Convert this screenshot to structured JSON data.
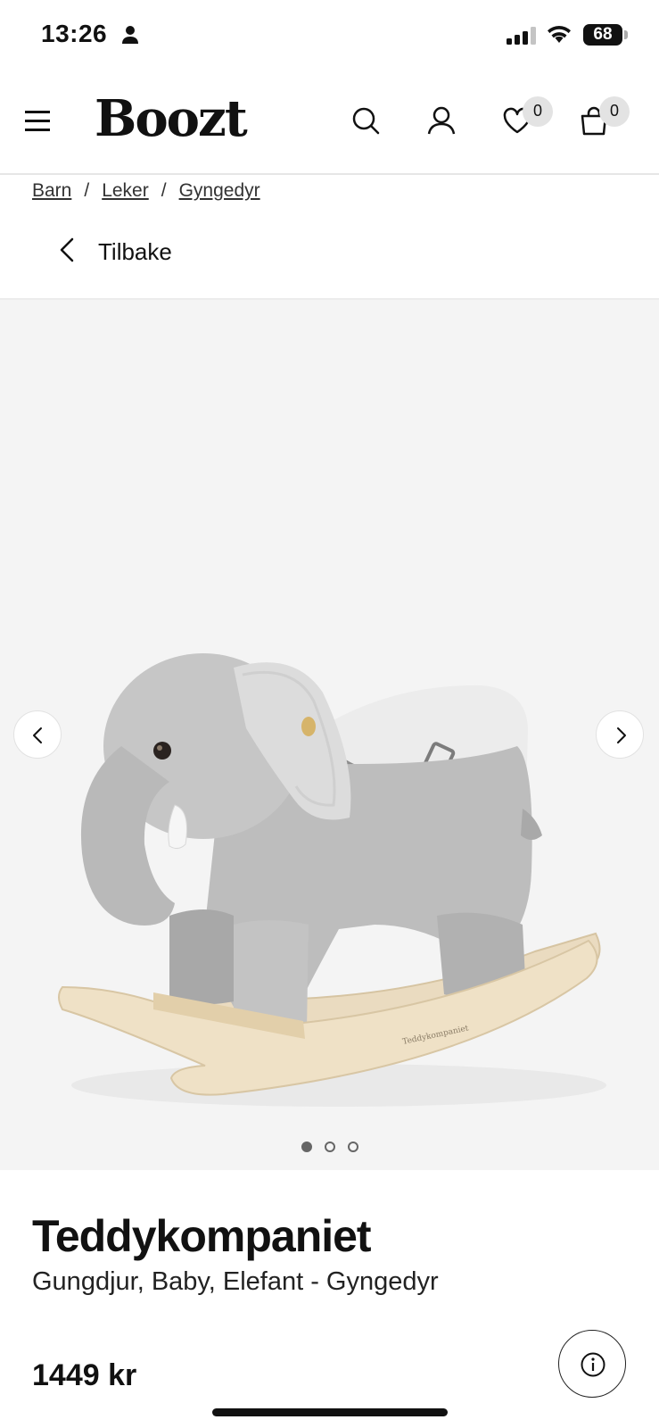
{
  "status_bar": {
    "time": "13:26",
    "battery": "68",
    "icons": [
      "person-icon",
      "signal-icon",
      "wifi-icon",
      "battery-icon"
    ]
  },
  "header": {
    "logo": "Boozt",
    "wishlist_count": "0",
    "cart_count": "0",
    "icons": [
      "menu-icon",
      "search-icon",
      "user-icon",
      "heart-icon",
      "bag-icon"
    ]
  },
  "breadcrumb": {
    "items": [
      "Barn",
      "Leker",
      "Gyngedyr"
    ],
    "separator": "/"
  },
  "back": {
    "label": "Tilbake"
  },
  "gallery": {
    "image_count": 3,
    "active_index": 0,
    "background": "#f4f4f4",
    "image_mark": "Teddykompaniet"
  },
  "product": {
    "brand": "Teddykompaniet",
    "name": "Gungdjur, Baby, Elefant - Gyngedyr",
    "price": "1449 kr"
  }
}
